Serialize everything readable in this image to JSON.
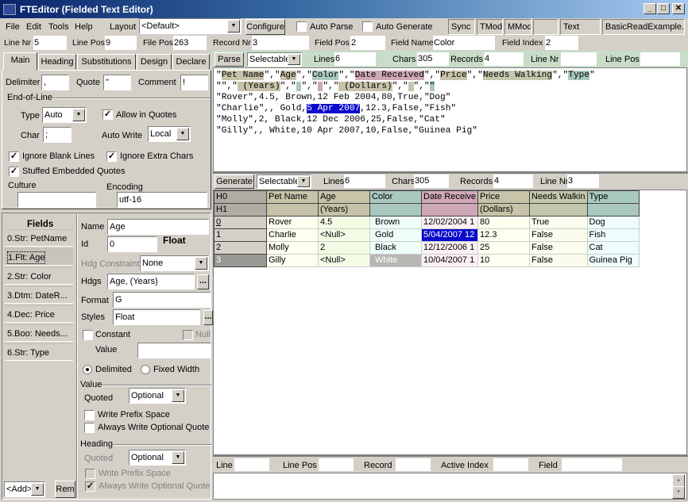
{
  "window": {
    "title": "FTEditor (Fielded Text Editor)",
    "minimize": "_",
    "maximize": "□",
    "close": "✕"
  },
  "menu": [
    {
      "label": "File"
    },
    {
      "label": "Edit"
    },
    {
      "label": "Tools"
    },
    {
      "label": "Help"
    }
  ],
  "toolbar": {
    "layout_label": "Layout",
    "layout_value": "<Default>",
    "configure_label": "Configure",
    "auto_parse_label": "Auto Parse",
    "auto_parse_checked": false,
    "auto_generate_label": "Auto Generate",
    "auto_generate_checked": false,
    "status_panels": [
      "Sync",
      "TMod",
      "MMod",
      "",
      "Text",
      "BasicReadExample.ft"
    ]
  },
  "position_bar": {
    "line_nr_label": "Line Nr",
    "line_nr": "5",
    "line_pos_label": "Line Pos",
    "line_pos": "9",
    "file_pos_label": "File Pos",
    "file_pos": "263",
    "record_nr_label": "Record Nr",
    "record_nr": "3",
    "field_pos_label": "Field Pos",
    "field_pos": "2",
    "field_name_label": "Field Name",
    "field_name": "Color",
    "field_index_label": "Field Index",
    "field_index": "2"
  },
  "tabs": [
    {
      "label": "Main",
      "active": true
    },
    {
      "label": "Heading"
    },
    {
      "label": "Substitutions"
    },
    {
      "label": "Design"
    },
    {
      "label": "Declare"
    }
  ],
  "main_tab": {
    "delimiter_label": "Delimiter",
    "delimiter": ",",
    "quote_label": "Quote",
    "quote": "\"",
    "comment_label": "Comment",
    "comment": "!",
    "eol_group": "End-of-Line",
    "type_label": "Type",
    "type_value": "Auto",
    "allow_in_quotes_label": "Allow in Quotes",
    "allow_in_quotes": true,
    "char_label": "Char",
    "char_value": ";",
    "auto_write_label": "Auto Write",
    "auto_write_value": "Local",
    "ignore_blank_lines_label": "Ignore Blank Lines",
    "ignore_blank_lines": true,
    "ignore_extra_chars_label": "Ignore Extra Chars",
    "ignore_extra_chars": true,
    "stuffed_quotes_label": "Stuffed Embedded Quotes",
    "stuffed_quotes": true,
    "culture_label": "Culture",
    "culture": "",
    "encoding_label": "Encoding",
    "encoding": "utf-16"
  },
  "fields_panel": {
    "title": "Fields",
    "items": [
      "0.Str: PetName",
      "1.Flt: Age",
      "2.Str: Color",
      "3.Dtm: DateR...",
      "4.Dec: Price",
      "5.Boo: Needs...",
      "6.Str: Type"
    ],
    "selected_index": 1,
    "add_value": "<Add>",
    "rem_label": "Rem"
  },
  "field_props": {
    "name_label": "Name",
    "name": "Age",
    "id_label": "Id",
    "id": "0",
    "type_badge": "Float",
    "hdg_constraint_label": "Hdg Constraint",
    "hdg_constraint": "None",
    "hdgs_label": "Hdgs",
    "hdgs": "Age, (Years)",
    "ellipsis": "...",
    "format_label": "Format",
    "format": "G",
    "styles_label": "Styles",
    "styles": "Float",
    "constant_label": "Constant",
    "constant": false,
    "null_label": "Null",
    "value_label": "Value",
    "value": "",
    "delimited_label": "Delimited",
    "fixed_width_label": "Fixed Width",
    "mode": "Delimited",
    "value_group": "Value",
    "quoted_label": "Quoted",
    "quoted": "Optional",
    "write_prefix_label": "Write Prefix Space",
    "write_prefix": false,
    "always_quote_label": "Always Write Optional Quote",
    "always_quote": false,
    "heading_group": "Heading",
    "h_quoted_label": "Quoted",
    "h_quoted": "Optional",
    "h_write_prefix_label": "Write Prefix Space",
    "h_write_prefix": false,
    "h_always_quote_label": "Always Write Optional Quote",
    "h_always_quote": true
  },
  "text_toolbar": {
    "parse_label": "Parse",
    "mode": "Selectable",
    "lines_label": "Lines",
    "lines": "6",
    "chars_label": "Chars",
    "chars": "305",
    "records_label": "Records",
    "records": "4",
    "line_nr_label": "Line Nr",
    "line_nr": "",
    "line_pos_label": "Line Pos",
    "line_pos": ""
  },
  "text_lines": [
    [
      [
        "\"",
        ""
      ],
      [
        "Pet Name",
        "#c6c3a8"
      ],
      [
        "\",\"",
        ""
      ],
      [
        "Age",
        "#c6c3a8"
      ],
      [
        "\",\"",
        ""
      ],
      [
        "Color",
        "#a9c8c0"
      ],
      [
        "\",\"",
        ""
      ],
      [
        "Date Received",
        "#cfa8b8"
      ],
      [
        "\",\"",
        ""
      ],
      [
        "Price",
        "#c6c3a8"
      ],
      [
        "\",\"",
        ""
      ],
      [
        "Needs Walking",
        "#c2c8ac"
      ],
      [
        "\",\"",
        ""
      ],
      [
        "Type",
        "#a9c8c0"
      ],
      [
        "\"",
        ""
      ]
    ],
    [
      [
        "\"\",\"",
        ""
      ],
      [
        " (Years)",
        "#c6c3a8"
      ],
      [
        "\",\"",
        ""
      ],
      [
        " ",
        "#a9c8c0"
      ],
      [
        "\",\"",
        ""
      ],
      [
        " ",
        "#cfa8b8"
      ],
      [
        "\",\"",
        ""
      ],
      [
        " (Dollars)",
        "#c6c3a8"
      ],
      [
        "\",\"",
        ""
      ],
      [
        " ",
        "#c2c8ac"
      ],
      [
        "\",\"",
        ""
      ],
      [
        "\"",
        "#a9c8c0"
      ]
    ],
    [
      [
        "\"Rover\",4.5, Brown,12 Feb 2004,80,True,\"Dog\"",
        ""
      ]
    ],
    [
      [
        "\"Charlie\",, Gold,",
        ""
      ],
      [
        "5 Apr 2007",
        "#0a0acc"
      ],
      [
        ",12.3,False,\"Fish\"",
        ""
      ]
    ],
    [
      [
        "\"Molly\",2, Black,12 Dec 2006,25,False,\"Cat\"",
        ""
      ]
    ],
    [
      [
        "\"Gilly\",, White,10 Apr 2007,10,False,\"Guinea Pig\"",
        ""
      ]
    ]
  ],
  "grid_toolbar": {
    "generate_label": "Generate",
    "mode": "Selectable",
    "lines_label": "Lines",
    "lines": "6",
    "chars_label": "Chars",
    "chars": "305",
    "records_label": "Records",
    "records": "4",
    "line_nr_label": "Line Nr",
    "line_nr": "3"
  },
  "grid": {
    "header_rows": [
      [
        "H0",
        "Pet Name",
        "Age",
        "Color",
        "Date Receive",
        "Price",
        "Needs Walkin",
        "Type"
      ],
      [
        "H1",
        "",
        "(Years)",
        "",
        "",
        "(Dollars)",
        "",
        ""
      ]
    ],
    "rows": [
      [
        "0",
        "Rover",
        "4.5",
        "Brown",
        "12/02/2004 1",
        "80",
        "True",
        "Dog"
      ],
      [
        "1",
        "Charlie",
        "<Null>",
        "Gold",
        "5/04/2007 12",
        "12.3",
        "False",
        "Fish"
      ],
      [
        "2",
        "Molly",
        "2",
        "Black",
        "12/12/2006 1",
        "25",
        "False",
        "Cat"
      ],
      [
        "3",
        "Gilly",
        "<Null>",
        "White",
        "10/04/2007 1",
        "10",
        "False",
        "Guinea Pig"
      ]
    ],
    "header_colors": [
      "#b0aca4",
      "#c6c3a8",
      "#c6c3a8",
      "#a9c8c0",
      "#cfa8b8",
      "#c6c3a8",
      "#c2c8ac",
      "#a9c8c0"
    ],
    "cell_colors": [
      "#d4d0c8",
      "#fffff0",
      "#f4fce6",
      "#eefcfa",
      "#fcf0f4",
      "#fffff0",
      "#fbfbee",
      "#eefcfc"
    ],
    "selected_cell": [
      1,
      4
    ],
    "current_row": 3,
    "current_col": 3
  },
  "bottom_bar": {
    "line_label": "Line",
    "line": "",
    "line_pos_label": "Line Pos",
    "line_pos": "",
    "record_label": "Record",
    "record": "",
    "active_index_label": "Active Index",
    "active_index": "",
    "field_label": "Field",
    "field": ""
  },
  "colors": {
    "selection": "#0a0acc",
    "title_start": "#0a246a",
    "title_end": "#a6caf0"
  }
}
